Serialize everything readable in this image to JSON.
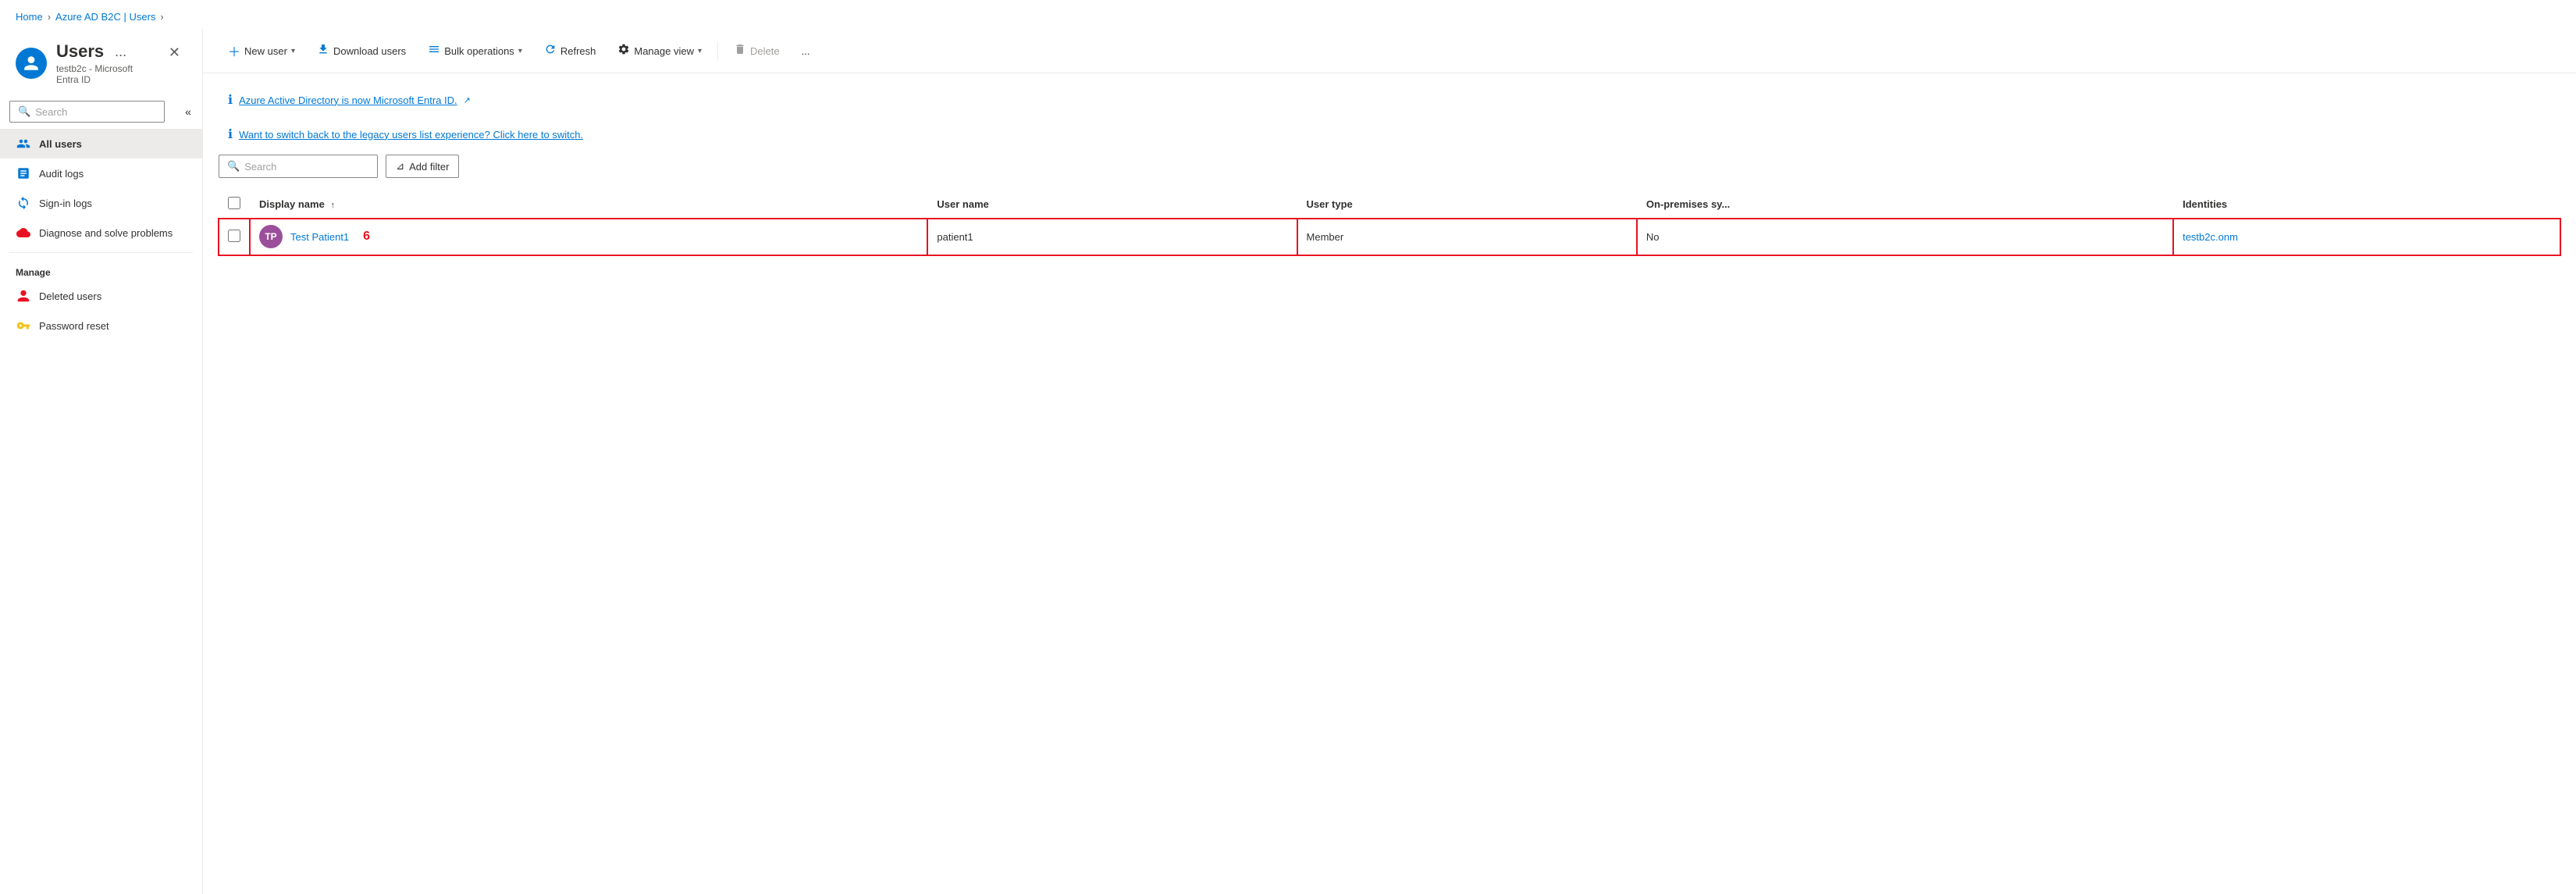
{
  "breadcrumb": {
    "items": [
      "Home",
      "Azure AD B2C | Users"
    ]
  },
  "sidebar": {
    "title": "Users",
    "dots": "...",
    "subtitle": "testb2c - Microsoft Entra ID",
    "search_placeholder": "Search",
    "collapse_icon": "«",
    "nav_items": [
      {
        "id": "all-users",
        "label": "All users",
        "icon": "people",
        "active": true
      },
      {
        "id": "audit-logs",
        "label": "Audit logs",
        "icon": "audit"
      },
      {
        "id": "sign-in-logs",
        "label": "Sign-in logs",
        "icon": "signin"
      },
      {
        "id": "diagnose",
        "label": "Diagnose and solve problems",
        "icon": "diagnose"
      }
    ],
    "manage_label": "Manage",
    "manage_items": [
      {
        "id": "deleted-users",
        "label": "Deleted users",
        "icon": "deleted"
      },
      {
        "id": "password-reset",
        "label": "Password reset",
        "icon": "password"
      }
    ]
  },
  "toolbar": {
    "new_user_label": "New user",
    "download_users_label": "Download users",
    "bulk_operations_label": "Bulk operations",
    "refresh_label": "Refresh",
    "manage_view_label": "Manage view",
    "delete_label": "Delete",
    "more_label": "..."
  },
  "banners": [
    {
      "text": "Azure Active Directory is now Microsoft Entra ID.",
      "link": true
    },
    {
      "text": "Want to switch back to the legacy users list experience? Click here to switch.",
      "link": true
    }
  ],
  "filter": {
    "search_placeholder": "Search",
    "add_filter_label": "Add filter",
    "filter_icon": "⊿"
  },
  "table": {
    "columns": [
      {
        "id": "display-name",
        "label": "Display name",
        "sort": "↑"
      },
      {
        "id": "user-name",
        "label": "User name"
      },
      {
        "id": "user-type",
        "label": "User type"
      },
      {
        "id": "on-premises",
        "label": "On-premises sy..."
      },
      {
        "id": "identities",
        "label": "Identities"
      }
    ],
    "rows": [
      {
        "id": "row-1",
        "highlighted": true,
        "avatar_initials": "TP",
        "avatar_color": "#9b4f9b",
        "display_name": "Test Patient1",
        "row_number": "6",
        "user_name": "patient1",
        "user_type": "Member",
        "on_premises": "No",
        "identity": "testb2c.onm",
        "identity_color": "#0078d4"
      }
    ]
  },
  "close_button": "✕"
}
